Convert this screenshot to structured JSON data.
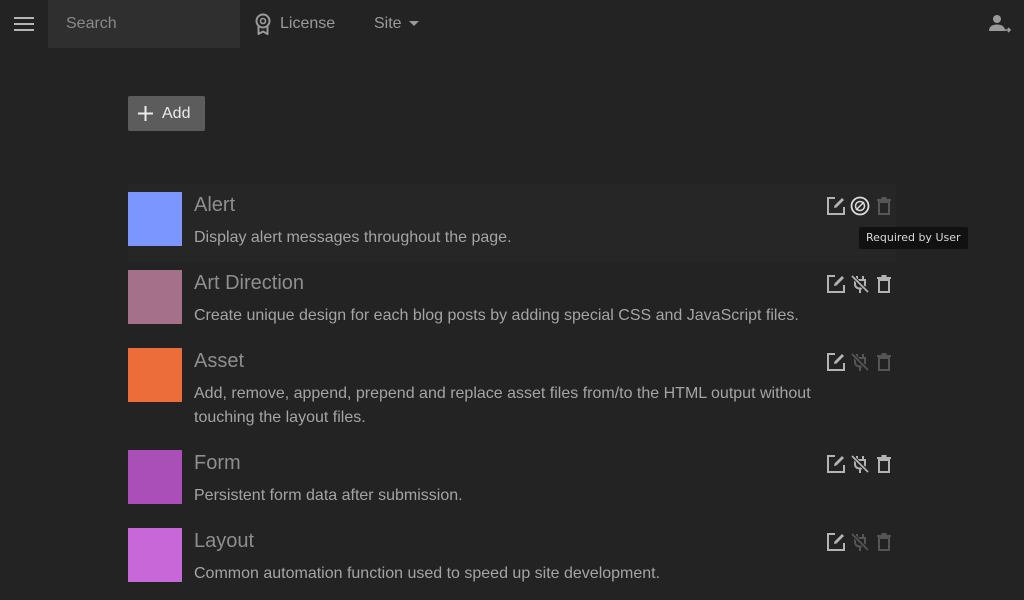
{
  "topbar": {
    "search_placeholder": "Search",
    "license_label": "License",
    "site_label": "Site",
    "menu_icon": "hamburger-menu-icon",
    "license_icon": "award-badge-icon",
    "user_icon": "account-switch-icon"
  },
  "toolbar": {
    "add_label": "Add"
  },
  "colors": {
    "background": "#232323",
    "add_button": "#5c5c5c"
  },
  "items": [
    {
      "title": "Alert",
      "description": "Display alert messages throughout the page.",
      "color": "#7b97ff",
      "required_by_user": true,
      "delete_enabled": false
    },
    {
      "title": "Art Direction",
      "description": "Create unique design for each blog posts by adding special CSS and JavaScript files.",
      "color": "#a5718a",
      "required_by_user": false,
      "delete_enabled": true
    },
    {
      "title": "Asset",
      "description": "Add, remove, append, prepend and replace asset files from/to the HTML output without touching the layout files.",
      "color": "#ec6c3a",
      "required_by_user": false,
      "delete_enabled": false
    },
    {
      "title": "Form",
      "description": "Persistent form data after submission.",
      "color": "#ab4fb8",
      "required_by_user": false,
      "delete_enabled": true
    },
    {
      "title": "Layout",
      "description": "Common automation function used to speed up site development.",
      "color": "#c868d8",
      "required_by_user": false,
      "delete_enabled": false
    }
  ],
  "tooltip": {
    "text": "Required by User"
  }
}
